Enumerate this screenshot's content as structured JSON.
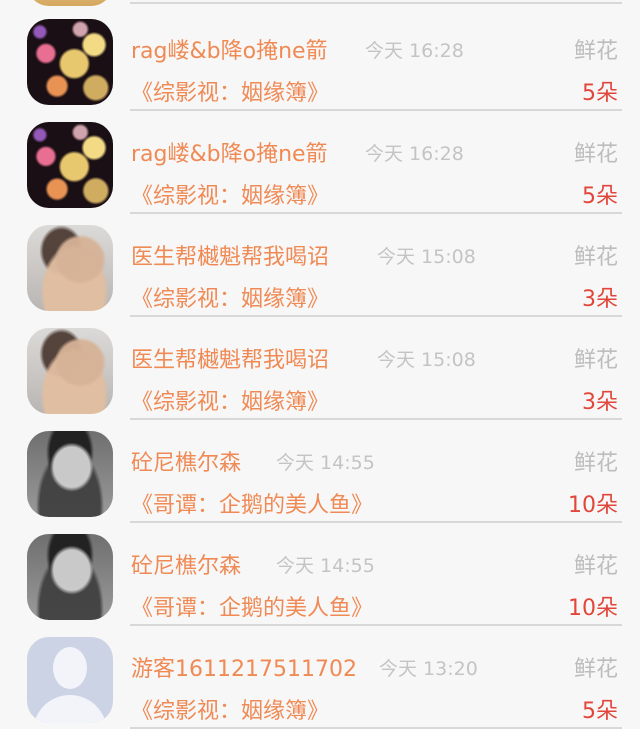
{
  "rows": [
    {
      "user": "rag嵝&b降o掩ne箭",
      "time": "今天 16:28",
      "gift": "鲜花",
      "book": "《综影视：姻缘簿》",
      "count": "5朵",
      "avatar": "bokeh"
    },
    {
      "user": "rag嵝&b降o掩ne箭",
      "time": "今天 16:28",
      "gift": "鲜花",
      "book": "《综影视：姻缘簿》",
      "count": "5朵",
      "avatar": "bokeh"
    },
    {
      "user": "医生帮樾魁帮我喝诏",
      "time": "今天 15:08",
      "gift": "鲜花",
      "book": "《综影视：姻缘簿》",
      "count": "3朵",
      "avatar": "man"
    },
    {
      "user": "医生帮樾魁帮我喝诏",
      "time": "今天 15:08",
      "gift": "鲜花",
      "book": "《综影视：姻缘簿》",
      "count": "3朵",
      "avatar": "man"
    },
    {
      "user": "砼尼樵尔森",
      "time": "今天 14:55",
      "gift": "鲜花",
      "book": "《哥谭：企鹅的美人鱼》",
      "count": "10朵",
      "avatar": "portrait"
    },
    {
      "user": "砼尼樵尔森",
      "time": "今天 14:55",
      "gift": "鲜花",
      "book": "《哥谭：企鹅的美人鱼》",
      "count": "10朵",
      "avatar": "portrait"
    },
    {
      "user": "游客1611217511702",
      "time": "今天 13:20",
      "gift": "鲜花",
      "book": "《综影视：姻缘簿》",
      "count": "5朵",
      "avatar": "guest"
    }
  ],
  "colors": {
    "username": "#f08a55",
    "count": "#e2463a",
    "muted": "#c4c4c4"
  }
}
